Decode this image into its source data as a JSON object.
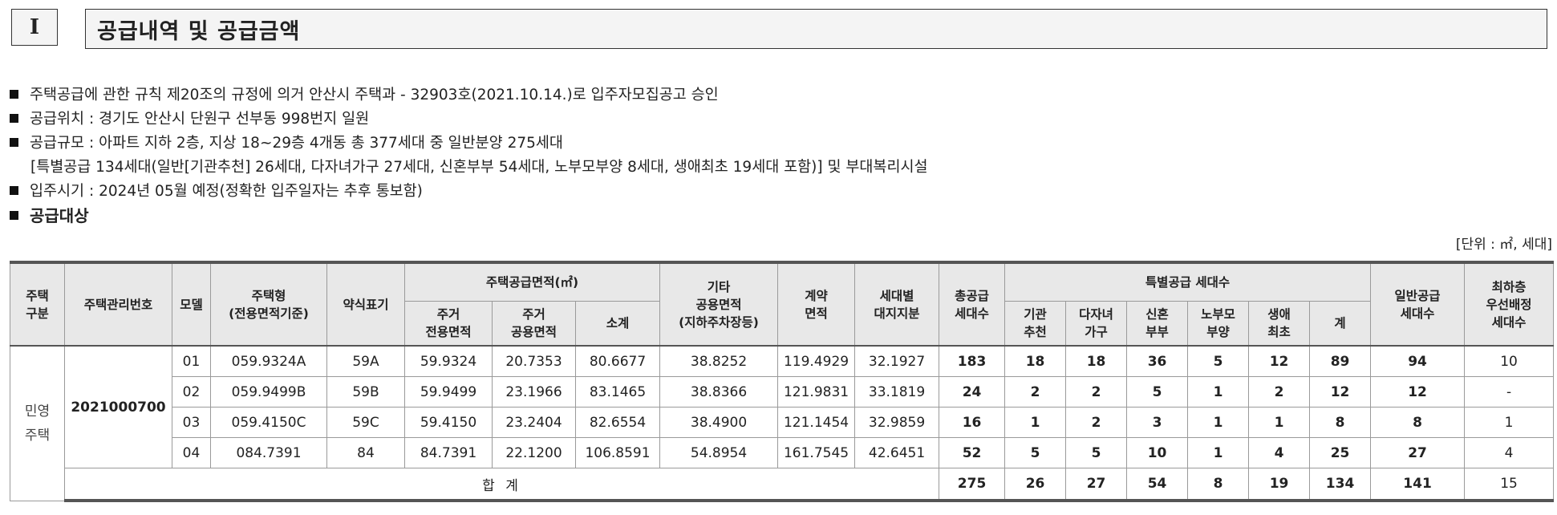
{
  "section": {
    "number": "I",
    "title": "공급내역 및 공급금액"
  },
  "bullets": [
    "주택공급에 관한 규칙 제20조의 규정에 의거 안산시 주택과 - 32903호(2021.10.14.)로 입주자모집공고 승인",
    "공급위치 : 경기도 안산시 단원구 선부동 998번지 일원",
    "공급규모 : 아파트 지하 2층, 지상 18~29층 4개동 총 377세대 중 일반분양 275세대",
    "[특별공급 134세대(일반[기관추천] 26세대, 다자녀가구 27세대, 신혼부부 54세대, 노부모부양 8세대, 생애최초 19세대 포함)] 및 부대복리시설",
    "입주시기 : 2024년 05월 예정(정확한 입주일자는 추후 통보함)"
  ],
  "subheading": "공급대상",
  "unit_note": "[단위 : ㎡, 세대]",
  "table": {
    "headers": {
      "type": "주택\n구분",
      "mgmt_no": "주택관리번호",
      "model": "모델",
      "housing_type": "주택형\n(전용면적기준)",
      "short_label": "약식표기",
      "supply_area": "주택공급면적(㎡)",
      "res_excl": "주거\n전용면적",
      "res_common": "주거\n공용면적",
      "subtotal": "소계",
      "other_common": "기타\n공용면적\n(지하주차장등)",
      "contract_area": "계약\n면적",
      "land_share": "세대별\n대지지분",
      "total_supply": "총공급\n세대수",
      "special": "특별공급 세대수",
      "inst": "기관\n추천",
      "multi": "다자녀\n가구",
      "newly": "신혼\n부부",
      "elder": "노부모\n부양",
      "first": "생애\n최초",
      "sp_sum": "계",
      "general": "일반공급\n세대수",
      "lowest": "최하층\n우선배정\n세대수"
    },
    "type_label": "민영\n주택",
    "mgmt_no": "2021000700",
    "rows": [
      {
        "model": "01",
        "housing_type": "059.9324A",
        "short": "59A",
        "res_excl": "59.9324",
        "res_common": "20.7353",
        "subtotal": "80.6677",
        "other_common": "38.8252",
        "contract": "119.4929",
        "land": "32.1927",
        "total": "183",
        "inst": "18",
        "multi": "18",
        "newly": "36",
        "elder": "5",
        "first": "12",
        "sp_sum": "89",
        "general": "94",
        "lowest": "10"
      },
      {
        "model": "02",
        "housing_type": "059.9499B",
        "short": "59B",
        "res_excl": "59.9499",
        "res_common": "23.1966",
        "subtotal": "83.1465",
        "other_common": "38.8366",
        "contract": "121.9831",
        "land": "33.1819",
        "total": "24",
        "inst": "2",
        "multi": "2",
        "newly": "5",
        "elder": "1",
        "first": "2",
        "sp_sum": "12",
        "general": "12",
        "lowest": "-"
      },
      {
        "model": "03",
        "housing_type": "059.4150C",
        "short": "59C",
        "res_excl": "59.4150",
        "res_common": "23.2404",
        "subtotal": "82.6554",
        "other_common": "38.4900",
        "contract": "121.1454",
        "land": "32.9859",
        "total": "16",
        "inst": "1",
        "multi": "2",
        "newly": "3",
        "elder": "1",
        "first": "1",
        "sp_sum": "8",
        "general": "8",
        "lowest": "1"
      },
      {
        "model": "04",
        "housing_type": "084.7391",
        "short": "84",
        "res_excl": "84.7391",
        "res_common": "22.1200",
        "subtotal": "106.8591",
        "other_common": "54.8954",
        "contract": "161.7545",
        "land": "42.6451",
        "total": "52",
        "inst": "5",
        "multi": "5",
        "newly": "10",
        "elder": "1",
        "first": "4",
        "sp_sum": "25",
        "general": "27",
        "lowest": "4"
      }
    ],
    "total": {
      "label": "합 계",
      "total": "275",
      "inst": "26",
      "multi": "27",
      "newly": "54",
      "elder": "8",
      "first": "19",
      "sp_sum": "134",
      "general": "141",
      "lowest": "15"
    }
  }
}
